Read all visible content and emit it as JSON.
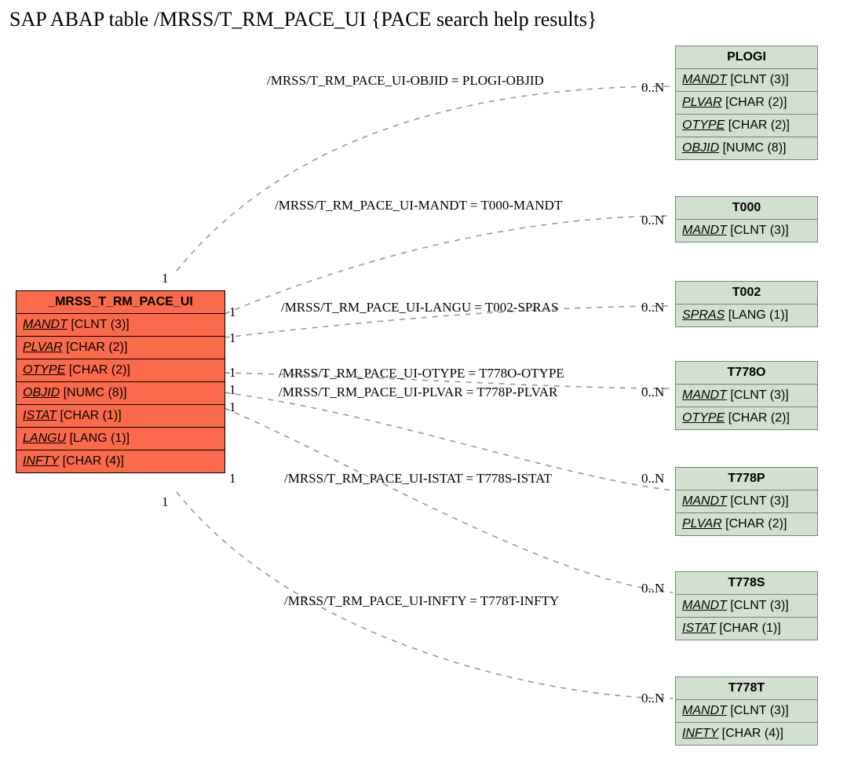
{
  "title": "SAP ABAP table /MRSS/T_RM_PACE_UI {PACE search help results}",
  "main": {
    "name": "_MRSS_T_RM_PACE_UI",
    "fields": [
      {
        "name": "MANDT",
        "type": "[CLNT (3)]"
      },
      {
        "name": "PLVAR",
        "type": "[CHAR (2)]"
      },
      {
        "name": "OTYPE",
        "type": "[CHAR (2)]"
      },
      {
        "name": "OBJID",
        "type": "[NUMC (8)]"
      },
      {
        "name": "ISTAT",
        "type": "[CHAR (1)]"
      },
      {
        "name": "LANGU",
        "type": "[LANG (1)]"
      },
      {
        "name": "INFTY",
        "type": "[CHAR (4)]"
      }
    ]
  },
  "refs": [
    {
      "name": "PLOGI",
      "fields": [
        {
          "name": "MANDT",
          "type": "[CLNT (3)]"
        },
        {
          "name": "PLVAR",
          "type": "[CHAR (2)]"
        },
        {
          "name": "OTYPE",
          "type": "[CHAR (2)]"
        },
        {
          "name": "OBJID",
          "type": "[NUMC (8)]"
        }
      ]
    },
    {
      "name": "T000",
      "fields": [
        {
          "name": "MANDT",
          "type": "[CLNT (3)]"
        }
      ]
    },
    {
      "name": "T002",
      "fields": [
        {
          "name": "SPRAS",
          "type": "[LANG (1)]"
        }
      ]
    },
    {
      "name": "T778O",
      "fields": [
        {
          "name": "MANDT",
          "type": "[CLNT (3)]"
        },
        {
          "name": "OTYPE",
          "type": "[CHAR (2)]"
        }
      ]
    },
    {
      "name": "T778P",
      "fields": [
        {
          "name": "MANDT",
          "type": "[CLNT (3)]"
        },
        {
          "name": "PLVAR",
          "type": "[CHAR (2)]"
        }
      ]
    },
    {
      "name": "T778S",
      "fields": [
        {
          "name": "MANDT",
          "type": "[CLNT (3)]"
        },
        {
          "name": "ISTAT",
          "type": "[CHAR (1)]"
        }
      ]
    },
    {
      "name": "T778T",
      "fields": [
        {
          "name": "MANDT",
          "type": "[CLNT (3)]"
        },
        {
          "name": "INFTY",
          "type": "[CHAR (4)]"
        }
      ]
    }
  ],
  "links": [
    {
      "label": "/MRSS/T_RM_PACE_UI-OBJID = PLOGI-OBJID",
      "left": "1",
      "right": "0..N"
    },
    {
      "label": "/MRSS/T_RM_PACE_UI-MANDT = T000-MANDT",
      "left": "1",
      "right": "0..N"
    },
    {
      "label": "/MRSS/T_RM_PACE_UI-LANGU = T002-SPRAS",
      "left": "1",
      "right": "0..N"
    },
    {
      "label": "/MRSS/T_RM_PACE_UI-OTYPE = T778O-OTYPE",
      "left": "1",
      "right": "0..N"
    },
    {
      "label": "/MRSS/T_RM_PACE_UI-PLVAR = T778P-PLVAR",
      "left": "1",
      "right": "0..N"
    },
    {
      "label": "/MRSS/T_RM_PACE_UI-ISTAT = T778S-ISTAT",
      "left": "1",
      "right": "0..N"
    },
    {
      "label": "/MRSS/T_RM_PACE_UI-INFTY = T778T-INFTY",
      "left": "1",
      "right": "0..N"
    }
  ]
}
